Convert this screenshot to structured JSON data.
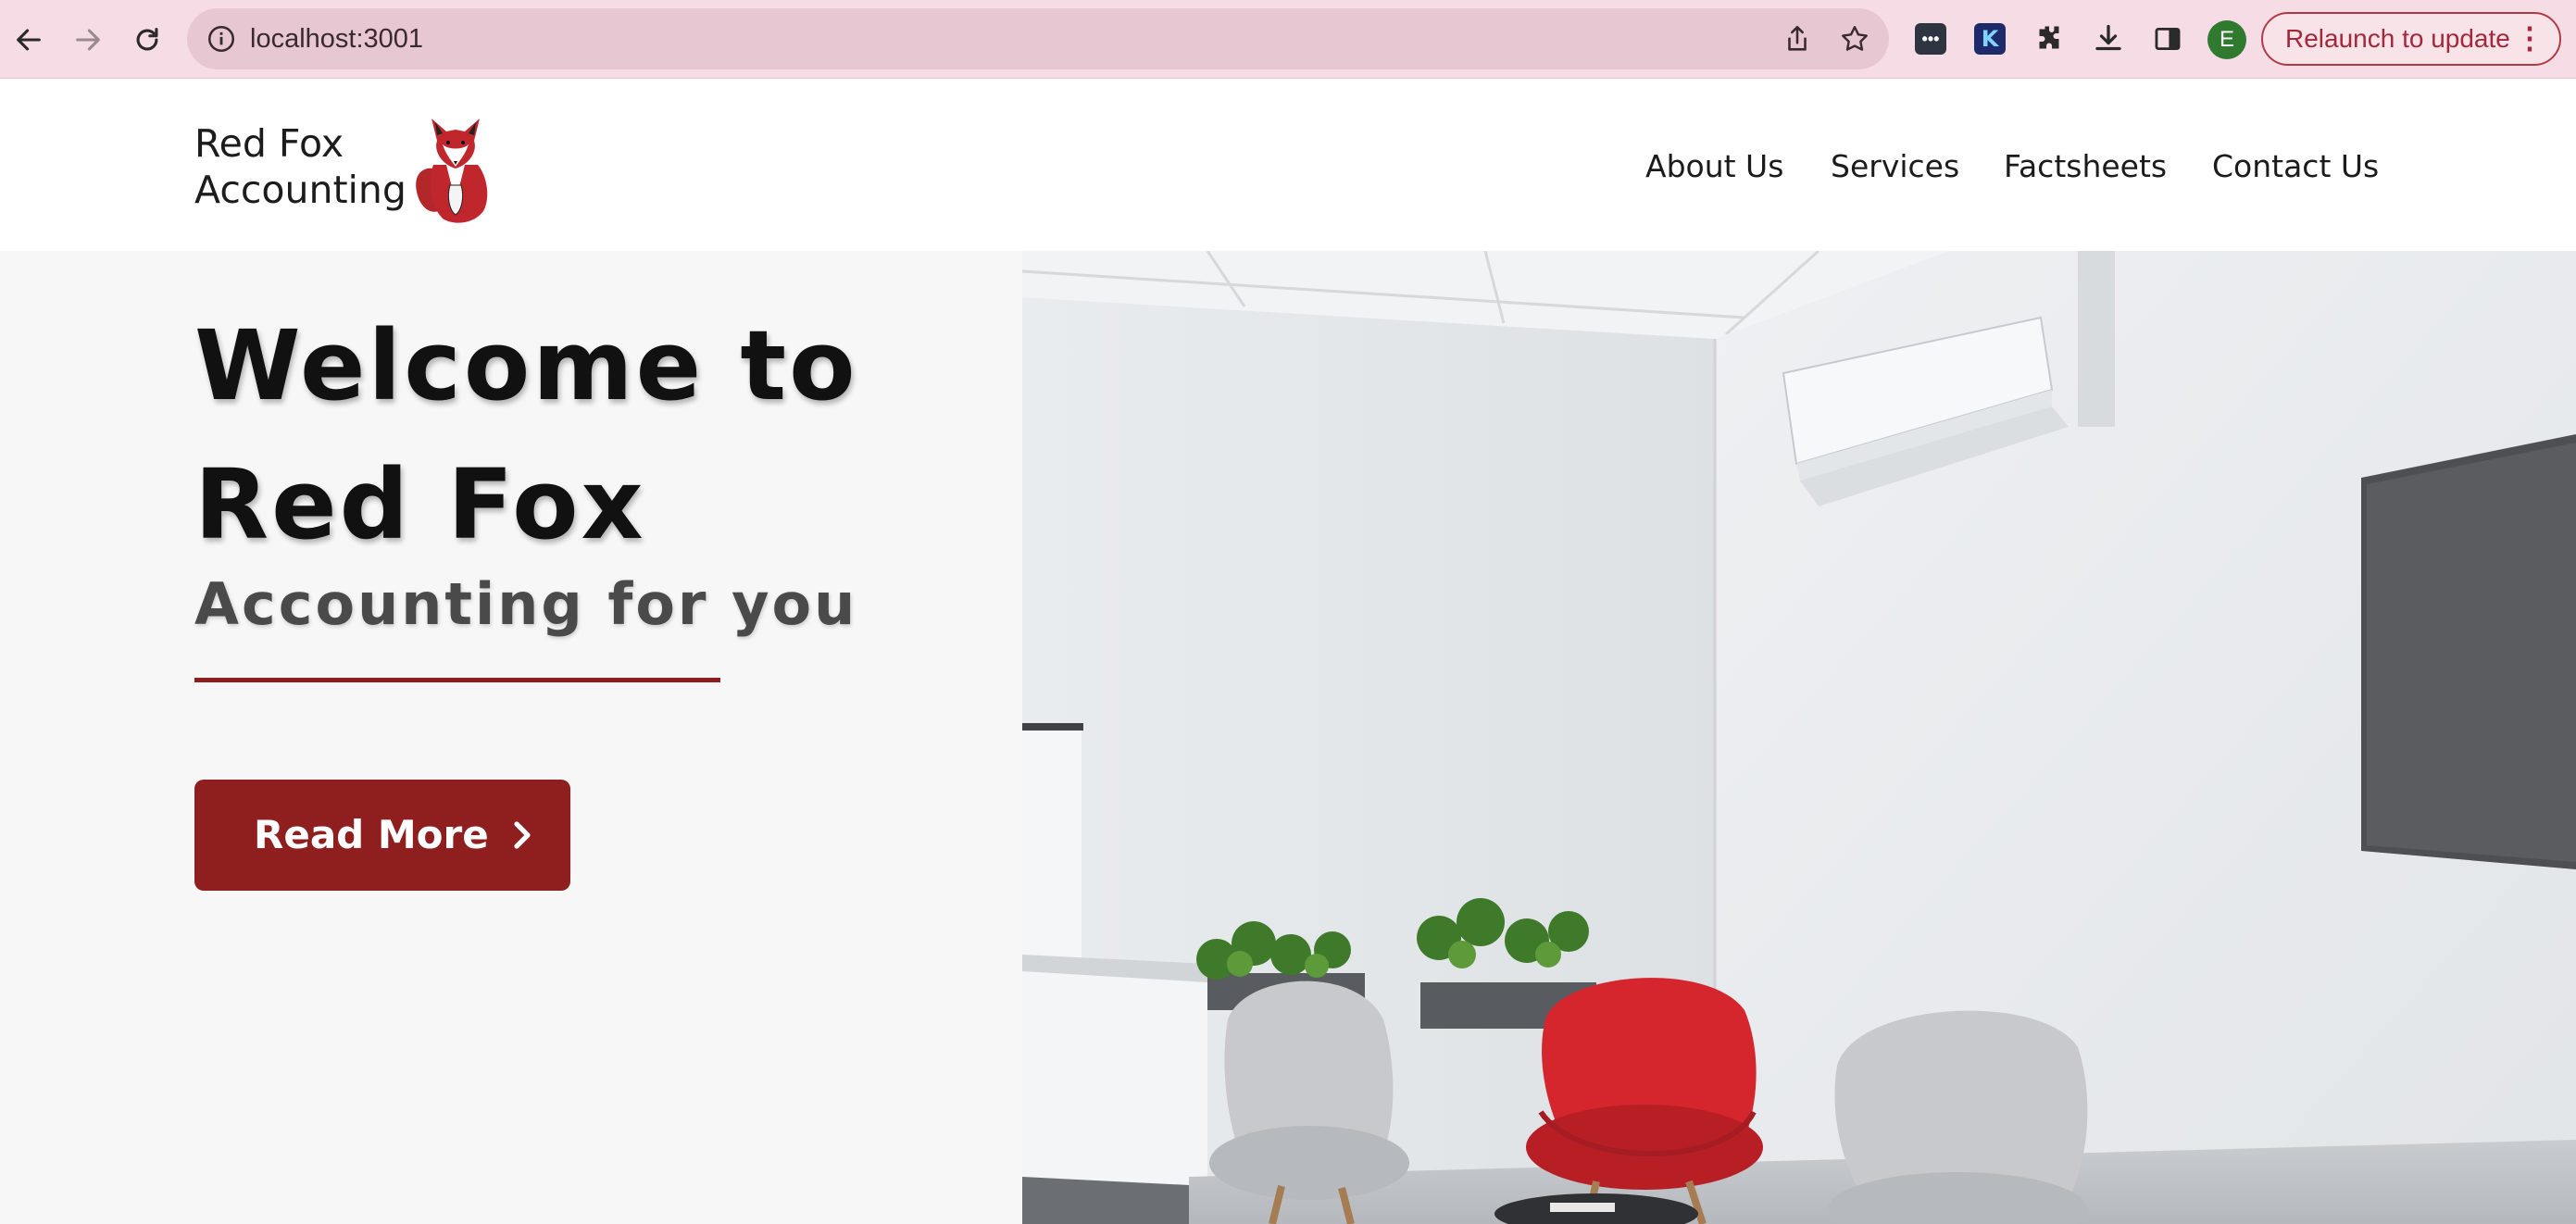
{
  "browser": {
    "url": "localhost:3001",
    "avatar_letter": "E",
    "relaunch_label": "Relaunch to update",
    "menu_glyph": "⋮",
    "icons": [
      "back-icon",
      "forward-icon",
      "reload-icon",
      "site-info-icon",
      "share-icon",
      "bookmark-star-icon",
      "password-manager-extension-icon",
      "k-extension-icon",
      "puzzle-extensions-icon",
      "download-icon",
      "side-panel-icon",
      "kebab-menu-icon"
    ],
    "colors": {
      "chrome_bg": "#f6dde5",
      "omnibox_bg": "#e7c8d2",
      "relaunch_accent": "#a3283b",
      "avatar_bg": "#2f7a2f"
    }
  },
  "site": {
    "logo": {
      "line1": "Red Fox",
      "line2": "Accounting",
      "icon": "red-fox-logo-icon"
    },
    "nav": [
      "About Us",
      "Services",
      "Factsheets",
      "Contact Us"
    ],
    "hero": {
      "title_line1": "Welcome to",
      "title_line2": "Red Fox",
      "subtitle": "Accounting for you",
      "cta_label": "Read More",
      "cta_icon": "chevron-right-icon",
      "image": "office-waiting-room-photo"
    },
    "colors": {
      "brand_red": "#8f1e1e",
      "hero_bg": "#f7f7f7",
      "text_dark": "#111111"
    }
  }
}
